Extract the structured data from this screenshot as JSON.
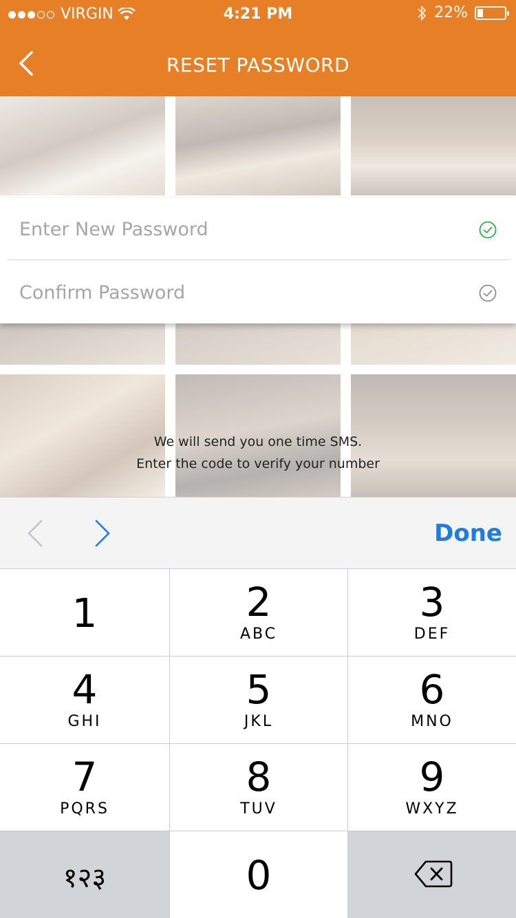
{
  "status_bar": {
    "carrier": "VIRGIN",
    "time": "4:21 PM",
    "battery": "22%",
    "battery_level": 0.22
  },
  "nav": {
    "title": "RESET PASSWORD",
    "back_icon": "chevron-left-icon"
  },
  "form": {
    "new_password_placeholder": "Enter New Password",
    "confirm_password_placeholder": "Confirm Password",
    "new_password_check_color": "#2bb24c",
    "confirm_password_check_color": "#8e8e93"
  },
  "sms": {
    "line1": "We will send you one time SMS.",
    "line2": "Enter the code to verify your number"
  },
  "accessory": {
    "done_label": "Done"
  },
  "keypad": {
    "keys": [
      {
        "num": "1",
        "letters": ""
      },
      {
        "num": "2",
        "letters": "ABC"
      },
      {
        "num": "3",
        "letters": "DEF"
      },
      {
        "num": "4",
        "letters": "GHI"
      },
      {
        "num": "5",
        "letters": "JKL"
      },
      {
        "num": "6",
        "letters": "MNO"
      },
      {
        "num": "7",
        "letters": "PQRS"
      },
      {
        "num": "8",
        "letters": "TUV"
      },
      {
        "num": "9",
        "letters": "WXYZ"
      }
    ],
    "alt_label": "१२३",
    "zero": "0",
    "delete_icon": "backspace-icon"
  },
  "colors": {
    "brand": "#e77f26",
    "accent": "#1e7ce3"
  }
}
